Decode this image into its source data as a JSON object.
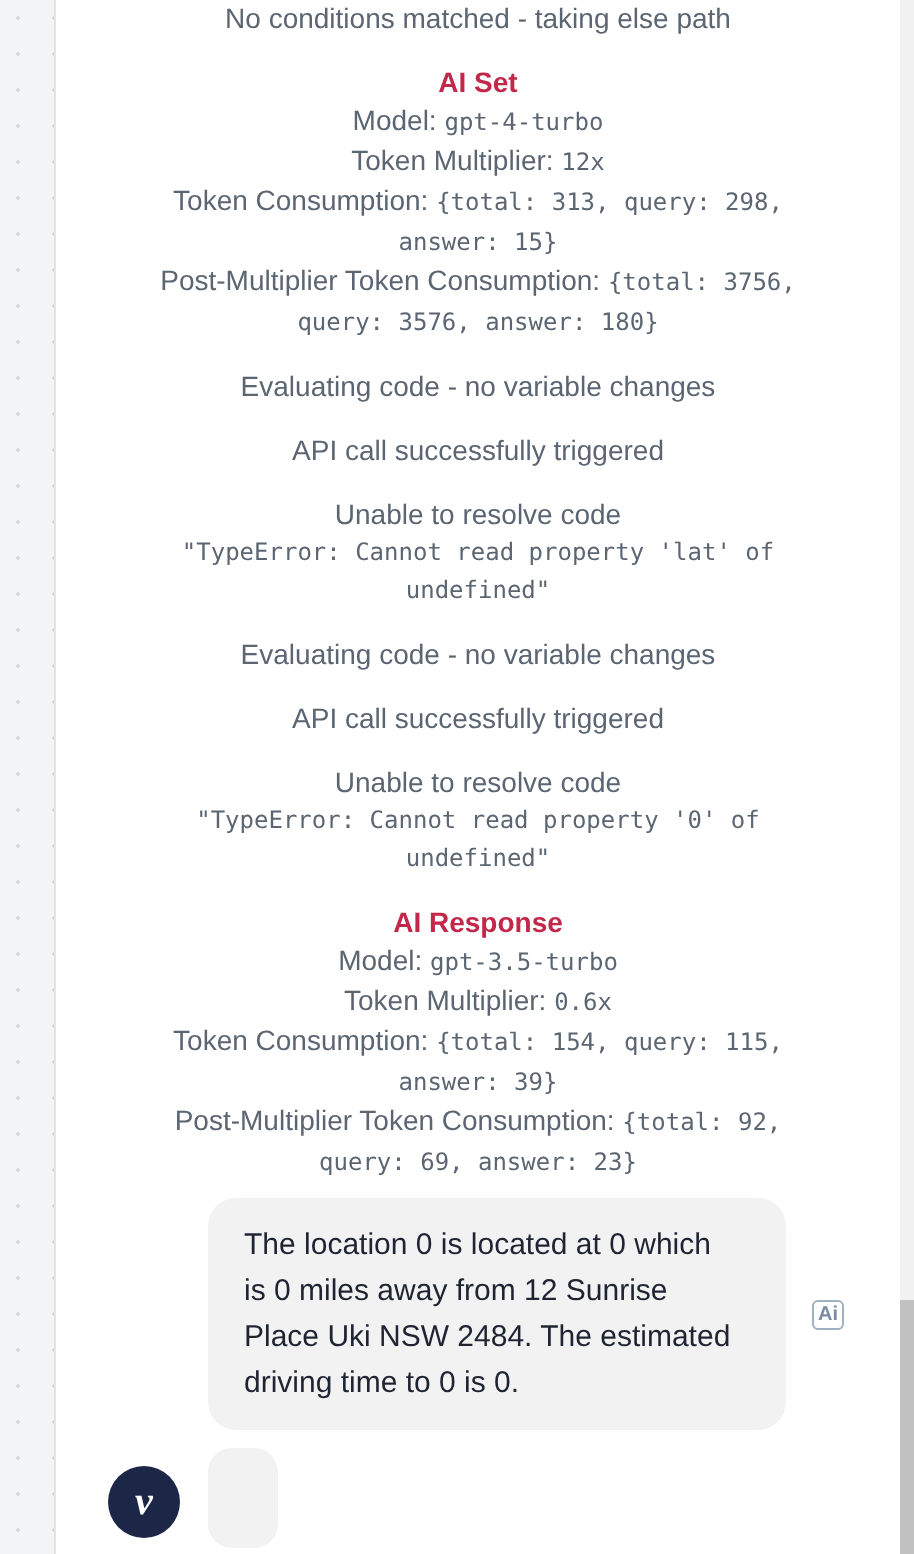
{
  "log": [
    {
      "kind": "text",
      "text": "No conditions matched - taking else path"
    },
    {
      "kind": "ai",
      "title": "AI Set",
      "lines": [
        {
          "label": "Model: ",
          "value": "gpt-4-turbo"
        },
        {
          "label": "Token Multiplier: ",
          "value": "12x"
        },
        {
          "label": "Token Consumption: ",
          "value": "{total: 313, query: 298, answer: 15}"
        },
        {
          "label": "Post-Multiplier Token Consumption: ",
          "value": "{total: 3756, query: 3576, answer: 180}"
        }
      ]
    },
    {
      "kind": "text",
      "text": "Evaluating code - no variable changes"
    },
    {
      "kind": "text",
      "text": "API call successfully triggered"
    },
    {
      "kind": "error",
      "title": "Unable to resolve code",
      "code": "\"TypeError: Cannot read property 'lat' of undefined\""
    },
    {
      "kind": "text",
      "text": "Evaluating code - no variable changes"
    },
    {
      "kind": "text",
      "text": "API call successfully triggered"
    },
    {
      "kind": "error",
      "title": "Unable to resolve code",
      "code": "\"TypeError: Cannot read property '0' of undefined\""
    },
    {
      "kind": "ai",
      "title": "AI Response",
      "lines": [
        {
          "label": "Model: ",
          "value": "gpt-3.5-turbo"
        },
        {
          "label": "Token Multiplier: ",
          "value": "0.6x"
        },
        {
          "label": "Token Consumption: ",
          "value": "{total: 154, query: 115, answer: 39}"
        },
        {
          "label": "Post-Multiplier Token Consumption: ",
          "value": "{total: 92, query: 69, answer: 23}"
        }
      ]
    }
  ],
  "message": {
    "text": "The location 0 is located at 0 which is 0 miles away from 12 Sunrise Place Uki NSW 2484. The estimated driving time to 0 is 0.",
    "badge": "Ai"
  },
  "avatar": {
    "letter": "v"
  }
}
